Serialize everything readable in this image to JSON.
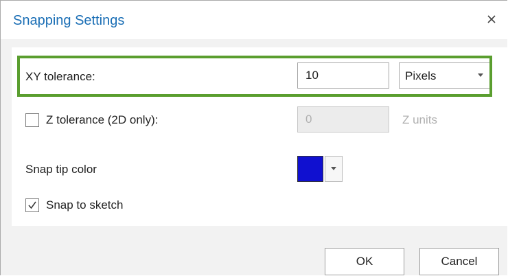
{
  "dialog": {
    "title": "Snapping Settings",
    "close_icon": "close-icon"
  },
  "xy_tolerance": {
    "label": "XY tolerance:",
    "value": "10",
    "unit_selected": "Pixels",
    "highlight_color": "#5a9e2f"
  },
  "z_tolerance": {
    "label": "Z tolerance (2D only):",
    "checked": false,
    "value": "0",
    "unit_label": "Z units"
  },
  "snap_tip": {
    "label": "Snap tip color",
    "color": "#1010d0"
  },
  "snap_to_sketch": {
    "label": "Snap to sketch",
    "checked": true
  },
  "buttons": {
    "ok": "OK",
    "cancel": "Cancel"
  },
  "colors": {
    "title": "#1a6eb5",
    "panel_background": "#ffffff",
    "dialog_background": "#f2f2f2"
  }
}
